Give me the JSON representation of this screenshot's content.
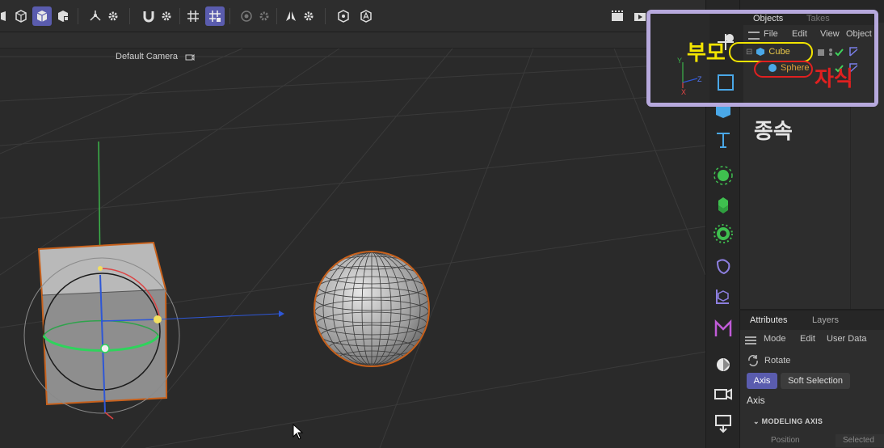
{
  "viewport": {
    "camera_label": "Default Camera"
  },
  "objects_panel": {
    "tabs": [
      "Objects",
      "Takes"
    ],
    "menu": [
      "File",
      "Edit",
      "View",
      "Object"
    ],
    "tree": [
      {
        "name": "Cube",
        "level": 0
      },
      {
        "name": "Sphere",
        "level": 1
      }
    ]
  },
  "attributes_panel": {
    "tabs": [
      "Attributes",
      "Layers"
    ],
    "menu": [
      "Mode",
      "Edit",
      "User Data"
    ],
    "tool_name": "Rotate",
    "subtabs": [
      "Axis",
      "Soft Selection"
    ],
    "active_subtab": "Axis",
    "section_title": "Axis",
    "group_title": "MODELING AXIS",
    "field_label": "Position",
    "field_value": "Selected"
  },
  "annotations": {
    "parent_label": "부모",
    "child_label": "자식",
    "subordinate_label": "종속"
  },
  "axes": {
    "y": "Y",
    "z": "Z",
    "x": "X"
  },
  "colors": {
    "accent": "#5a5cae",
    "overlay_border": "#b7a9dd",
    "parent_highlight": "#f2e400",
    "child_highlight": "#e02020",
    "cube_tree": "#e8c84a",
    "sphere_tree": "#e0a23a",
    "selection_orange": "#c8611c"
  }
}
